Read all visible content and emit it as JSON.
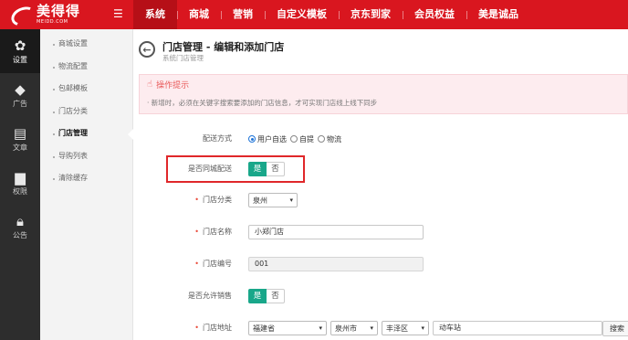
{
  "brand": {
    "name_cn": "美得得",
    "name_en": "MEIDD.COM"
  },
  "topnav": [
    {
      "label": "系统",
      "active": true
    },
    {
      "label": "商城",
      "active": false
    },
    {
      "label": "营销",
      "active": false
    },
    {
      "label": "自定义模板",
      "active": false
    },
    {
      "label": "京东到家",
      "active": false
    },
    {
      "label": "会员权益",
      "active": false
    },
    {
      "label": "美是诚品",
      "active": false
    }
  ],
  "sidebar": [
    {
      "label": "设置",
      "icon": "gear-icon",
      "active": true
    },
    {
      "label": "广告",
      "icon": "diamond-icon",
      "active": false
    },
    {
      "label": "文章",
      "icon": "article-icon",
      "active": false
    },
    {
      "label": "权限",
      "icon": "document-icon",
      "active": false
    },
    {
      "label": "公告",
      "icon": "lock-icon",
      "active": false
    }
  ],
  "submenu": [
    {
      "label": "商城设置",
      "active": false
    },
    {
      "label": "物流配置",
      "active": false
    },
    {
      "label": "包邮模板",
      "active": false
    },
    {
      "label": "门店分类",
      "active": false
    },
    {
      "label": "门店管理",
      "active": true
    },
    {
      "label": "导购列表",
      "active": false
    },
    {
      "label": "清除缓存",
      "active": false
    }
  ],
  "page": {
    "title": "门店管理 - 编辑和添加门店",
    "breadcrumb": "系统门店管理"
  },
  "tips": {
    "heading": "操作提示",
    "text": "· 新增时，必须在关键字搜索要添加的门店信息，才可实现门店线上线下同步"
  },
  "form": {
    "delivery": {
      "label": "配送方式",
      "options": [
        {
          "label": "用户自选",
          "checked": true
        },
        {
          "label": "自提",
          "checked": false
        },
        {
          "label": "物流",
          "checked": false
        }
      ]
    },
    "same_city": {
      "label": "是否同城配送",
      "yes": "是",
      "no": "否"
    },
    "category": {
      "label": "门店分类",
      "value": "泉州"
    },
    "store_name": {
      "label": "门店名称",
      "value": "小郑门店"
    },
    "store_code": {
      "label": "门店编号",
      "value": "001"
    },
    "allow_sale": {
      "label": "是否允许销售",
      "yes": "是",
      "no": "否"
    },
    "address": {
      "label": "门店地址",
      "province": "福建省",
      "city": "泉州市",
      "district": "丰泽区",
      "detail": "动车站",
      "search_label": "搜索"
    }
  },
  "colors": {
    "brand_red": "#d9161f",
    "switch_green": "#19a78a",
    "highlight_red": "#e0272a",
    "tips_bg": "#fdecef"
  }
}
